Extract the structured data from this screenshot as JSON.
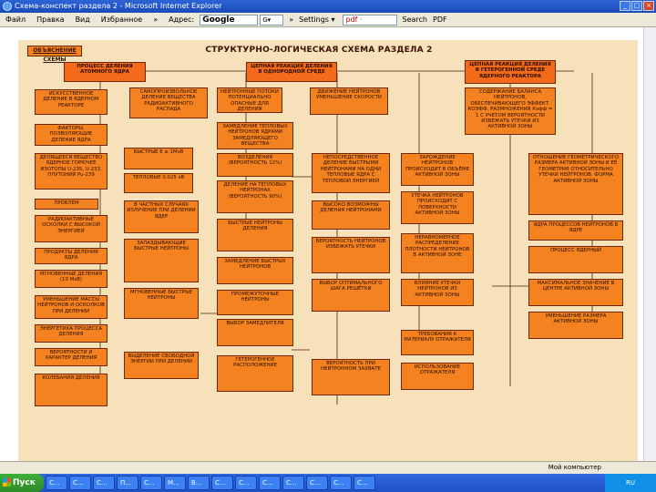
{
  "window": {
    "title": "Схема-конспект раздела 2 - Microsoft Internet Explorer"
  },
  "menu": [
    "Файл",
    "Правка",
    "Вид",
    "Избранное",
    "»"
  ],
  "address_label": "Адрес:",
  "google": {
    "logo": "Google",
    "combo": "G▾"
  },
  "toolbar": {
    "more": "»",
    "settings": "Settings ▾",
    "pdf": "pdf ·",
    "search": "Search",
    "pdf_btn": "PDF"
  },
  "slide": {
    "tag": "ОБЪЯСНЕНИЕ СХЕМЫ",
    "title": "СТРУКТУРНО-ЛОГИЧЕСКАЯ СХЕМА РАЗДЕЛА 2",
    "boxes": [
      {
        "id": "b1",
        "text": "ПРОЦЕСС ДЕЛЕНИЯ АТОМНОГО ЯДРА"
      },
      {
        "id": "b2",
        "text": "ЦЕПНАЯ РЕАКЦИЯ ДЕЛЕНИЯ В ОДНОРОДНОЙ СРЕДЕ"
      },
      {
        "id": "b3",
        "text": "ЦЕПНАЯ РЕАКЦИЯ ДЕЛЕНИЯ В ГЕТЕРОГЕННОЙ СРЕДЕ ЯДЕРНОГО РЕАКТОРА"
      },
      {
        "id": "b4",
        "text": "ИСКУССТВЕННОЕ ДЕЛЕНИЕ В ЯДЕРНОМ РЕАКТОРЕ"
      },
      {
        "id": "b5",
        "text": "САМОПРОИЗВОЛЬНОЕ ДЕЛЕНИЕ ВЕЩЕСТВА РАДИОАКТИВНОГО РАСПАДА"
      },
      {
        "id": "b6",
        "text": "НЕЙТРОННЫЕ ПОТОКИ ПОТЕНЦИАЛЬНО ОПАСНЫЕ ДЛЯ ДЕЛЕНИЯ"
      },
      {
        "id": "b7",
        "text": "ДВИЖЕНИЕ НЕЙТРОНОВ УМЕНЬШЕНИЕ СКОРОСТИ"
      },
      {
        "id": "b8",
        "text": "СОДЕРЖАНИЕ БАЛАНСА НЕЙТРОНОВ, ОБЕСПЕЧИВАЮЩЕГО ЭФФЕКТ. КОЭФФ. РАЗМНОЖЕНИЯ Кэфф = 1 С УЧЕТОМ ВЕРОЯТНОСТИ ИЗБЕЖАТЬ УТЕЧКИ ИЗ АКТИВНОЙ ЗОНЫ"
      },
      {
        "id": "b9",
        "text": "ФАКТОРЫ, ПОЗВОЛЯЮЩИЕ ДЕЛЕНИЕ ЯДРА"
      },
      {
        "id": "b10",
        "text": "ЗАМЕДЛЕНИЕ ТЕПЛОВЫХ НЕЙТРОНОВ ЯДРАМИ ЗАМЕДЛЯЮЩЕГО ВЕЩЕСТВА"
      },
      {
        "id": "b11",
        "text": "ДЕЛЯЩЕЕСЯ ВЕЩЕСТВО ЯДЕРНОЕ ГОРЮЧЕЕ ИЗОТОПЫ U-235, U-233, ПЛУТОНИЙ Pu-239"
      },
      {
        "id": "b12",
        "text": "БЫСТРЫЕ E ≥ 1МэВ"
      },
      {
        "id": "b13",
        "text": "ТЕПЛОВЫЕ 0.025 эВ"
      },
      {
        "id": "b14",
        "text": "ВОЗДЕЛЕНИЯ (ВЕРОЯТНОСТЬ 12%)"
      },
      {
        "id": "b15",
        "text": "ДЕЛЕНИЕ НА ТЕПЛОВЫХ НЕЙТРОНАХ (ВЕРОЯТНОСТЬ 90%)"
      },
      {
        "id": "b16",
        "text": "НЕПОСРЕДСТВЕННОЕ ДЕЛЕНИЕ БЫСТРЫМИ НЕЙТРОНАМИ НА ОДНИ ТЕПЛОВЫЕ ЯДРА С ТЕПЛОВОЙ ЭНЕРГИЕЙ"
      },
      {
        "id": "b17",
        "text": "ЗАРОЖДЕНИЕ НЕЙТРОНОВ ПРОИСХОДИТ В ОБЪЁМЕ АКТИВНОЙ ЗОНЫ"
      },
      {
        "id": "b18",
        "text": "ОТНОШЕНИЕ ГЕОМЕТРИЧЕСКОГО РАЗМЕРА АКТИВНОЙ ЗОНЫ И ЕЁ ГЕОМЕТРИЯ ОТНОСИТЕЛЬНО УТЕЧКИ НЕЙТРОНОВ. ФОРМА АКТИВНОЙ ЗОНЫ"
      },
      {
        "id": "b19",
        "text": "ПРОБЛЕМ"
      },
      {
        "id": "b20",
        "text": "В ЧАСТНЫХ СЛУЧАЯХ ИЗЛУЧЕНИЕ ПРИ ДЕЛЕНИИ ЯДЕР"
      },
      {
        "id": "b21",
        "text": "ВЫСОКО ВОЗМОЖНЫ ДЕЛЕНИЯ НЕЙТРОНАМИ"
      },
      {
        "id": "b22",
        "text": "УТЕЧКА НЕЙТРОНОВ ПРОИСХОДИТ С ПОВЕРХНОСТИ АКТИВНОЙ ЗОНЫ"
      },
      {
        "id": "b23",
        "text": "РАДИОАКТИВНЫЕ ОСКОЛКИ С ВЫСОКОЙ ЭНЕРГИЕЙ"
      },
      {
        "id": "b24",
        "text": "БЫСТРЫЕ НЕЙТРОНЫ ДЕЛЕНИЯ"
      },
      {
        "id": "b25",
        "text": "ЯДРА ПРОЦЕССОВ НЕЙТРОНОВ В ЯДРЕ"
      },
      {
        "id": "b26",
        "text": "ПРОДУКТЫ ДЕЛЕНИЯ ЯДРА"
      },
      {
        "id": "b27",
        "text": "ЗАПАЗДЫВАЮЩИЕ БЫСТРЫЕ НЕЙТРОНЫ"
      },
      {
        "id": "b28",
        "text": "ЗАМЕДЛЕНИЕ БЫСТРЫХ НЕЙТРОНОВ"
      },
      {
        "id": "b29",
        "text": "ВЕРОЯТНОСТЬ НЕЙТРОНОВ ИЗБЕЖАТЬ УТЕЧКИ"
      },
      {
        "id": "b30",
        "text": "НЕРАВНОМЕРНОЕ РАСПРЕДЕЛЕНИЕ ПЛОТНОСТИ НЕЙТРОНОВ В АКТИВНОЙ ЗОНЕ"
      },
      {
        "id": "b31",
        "text": "ПРОЦЕСС ЯДЕРНЫЙ"
      },
      {
        "id": "b32",
        "text": "МГНОВЕННЫЕ ДЕЛЕНИЯ (10 МэВ)"
      },
      {
        "id": "b33",
        "text": "МГНОВЕННЫЕ БЫСТРЫЕ НЕЙТРОНЫ"
      },
      {
        "id": "b34",
        "text": "ВЫБОР ОПТИМАЛЬНОГО ШАГА РЕШЁТКИ"
      },
      {
        "id": "b35",
        "text": "ВЛИЯНИЕ УТЕЧКИ НЕЙТРОНОВ ИЗ АКТИВНОЙ ЗОНЫ"
      },
      {
        "id": "b36",
        "text": "МАКСИМАЛЬНОЕ ЗНАЧЕНИЕ В ЦЕНТРЕ АКТИВНОЙ ЗОНЫ"
      },
      {
        "id": "b37",
        "text": "УМЕНЬШЕНИЕ МАССЫ НЕЙТРОНОВ И ОСКОЛКОВ ПРИ ДЕЛЕНИИ"
      },
      {
        "id": "b38",
        "text": "ПРОМЕЖУТОЧНЫЕ НЕЙТРОНЫ"
      },
      {
        "id": "b39",
        "text": "ВЫБОР ЗАМЕДЛИТЕЛЯ"
      },
      {
        "id": "b40",
        "text": "УМЕНЬШЕНИЕ РАЗМЕРА АКТИВНОЙ ЗОНЫ"
      },
      {
        "id": "b41",
        "text": "ЭНЕРГЕТИКА ПРОЦЕССА ДЕЛЕНИЯ"
      },
      {
        "id": "b42",
        "text": "ВЫДЕЛЕНИЕ СВОБОДНОЙ ЭНЕРГИИ ПРИ ДЕЛЕНИИ"
      },
      {
        "id": "b43",
        "text": "ТРЕБОВАНИЯ К МАТЕРИАЛУ ОТРАЖАТЕЛЯ"
      },
      {
        "id": "b44",
        "text": "ВЕРОЯТНОСТИ И ХАРАКТЕР ДЕЛЕНИЯ"
      },
      {
        "id": "b45",
        "text": "ИСПОЛЬЗОВАНИЕ ОТРАЖАТЕЛЯ"
      },
      {
        "id": "b46",
        "text": "КОЛЕБАНИЯ ДЕЛЕНИЯ"
      },
      {
        "id": "b47",
        "text": "ГЕТЕРОГЕННОЕ РАСПОЛОЖЕНИЕ"
      },
      {
        "id": "b48",
        "text": "ВЕРОЯТНОСТЬ ПРИ НЕЙТРОННОМ ЗАХВАТЕ"
      }
    ]
  },
  "status": {
    "left": "",
    "zone": "Мой компьютер"
  },
  "taskbar": {
    "start": "Пуск",
    "tasks": [
      "С...",
      "С...",
      "С...",
      "П...",
      "С...",
      "М...",
      "В...",
      "С...",
      "С...",
      "С...",
      "С...",
      "С...",
      "С...",
      "С..."
    ],
    "clock": "RU"
  }
}
